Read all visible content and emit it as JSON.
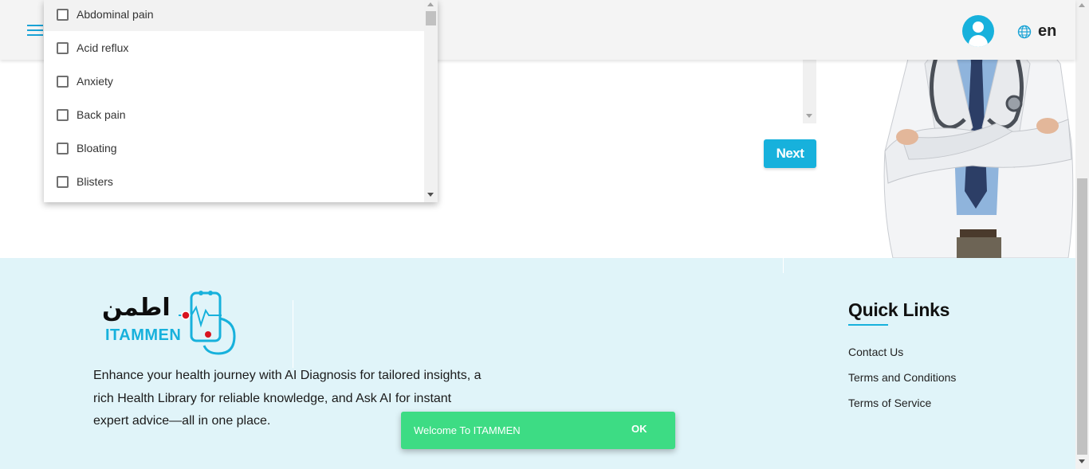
{
  "header": {
    "language": "en"
  },
  "symptom_dropdown": {
    "options": [
      {
        "label": "Abdominal pain",
        "checked": false
      },
      {
        "label": "Acid reflux",
        "checked": false
      },
      {
        "label": "Anxiety",
        "checked": false
      },
      {
        "label": "Back pain",
        "checked": false
      },
      {
        "label": "Bloating",
        "checked": false
      },
      {
        "label": "Blisters",
        "checked": false
      }
    ]
  },
  "main": {
    "next_label": "Next"
  },
  "footer": {
    "logo": {
      "arabic_text": "اطمن",
      "brand_text": "ITAMMEN"
    },
    "description": "Enhance your health journey with AI Diagnosis for tailored insights, a rich Health Library for reliable knowledge, and Ask AI for instant expert advice—all in one place.",
    "quick_links": {
      "title": "Quick Links",
      "links": [
        "Contact Us",
        "Terms and Conditions",
        "Terms of Service"
      ]
    }
  },
  "snackbar": {
    "message": "Welcome To ITAMMEN",
    "action": "OK"
  },
  "colors": {
    "accent": "#17b1dc",
    "footer_bg": "#e0f4f9",
    "snackbar_bg": "#3ddc84",
    "header_bg": "#f4f4f4"
  },
  "icons": [
    "menu-icon",
    "user-avatar-icon",
    "globe-icon",
    "checkbox-icon",
    "stethoscope-phone-logo"
  ]
}
